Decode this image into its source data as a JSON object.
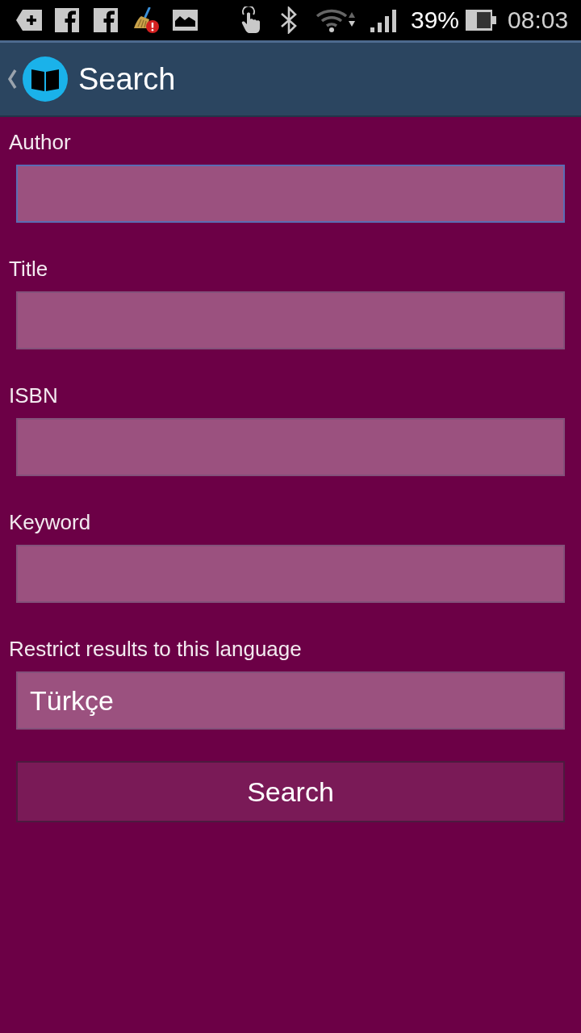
{
  "status_bar": {
    "battery": "39%",
    "time": "08:03"
  },
  "app_bar": {
    "title": "Search"
  },
  "fields": [
    {
      "label": "Author",
      "focused": true
    },
    {
      "label": "Title",
      "focused": false
    },
    {
      "label": "ISBN",
      "focused": false
    },
    {
      "label": "Keyword",
      "focused": false
    },
    {
      "label": "Restrict results to this language",
      "value": "Türkçe",
      "focused": false
    }
  ],
  "search_button": {
    "label": "Search"
  }
}
